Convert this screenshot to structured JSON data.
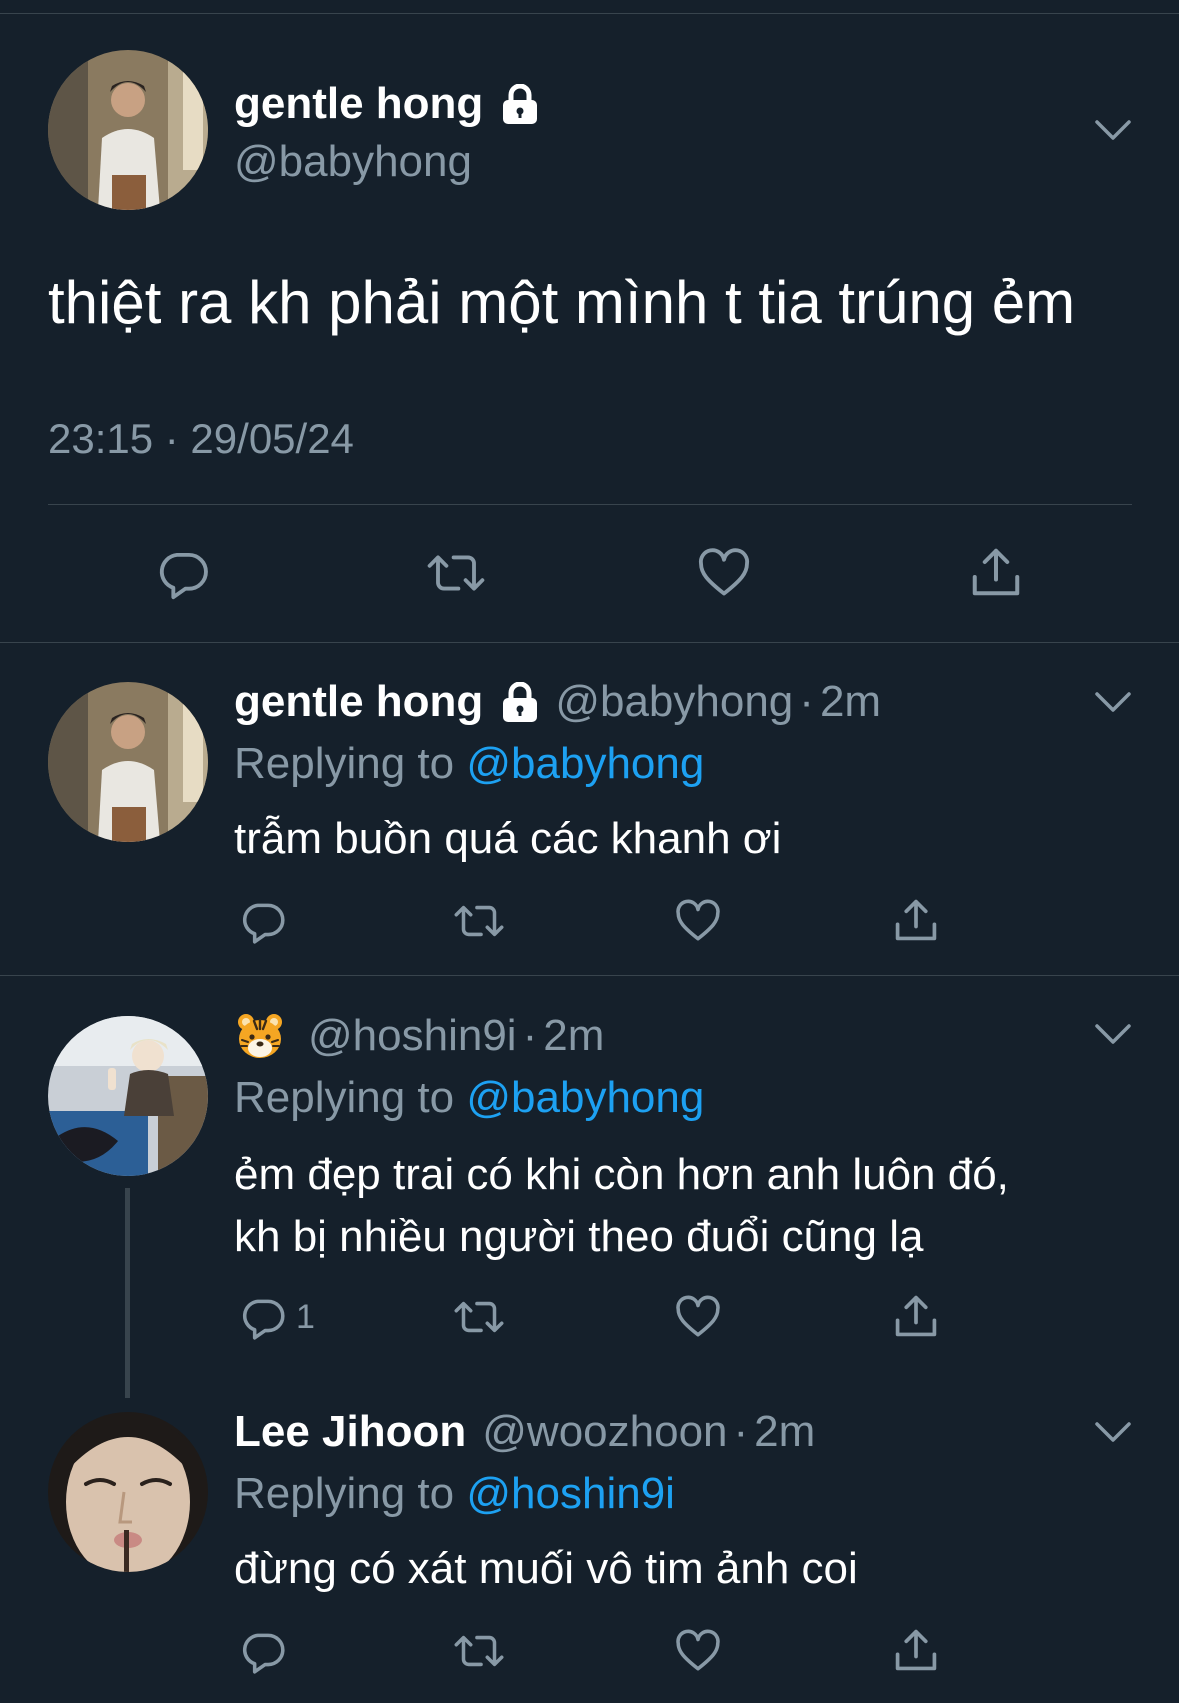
{
  "main_tweet": {
    "name": "gentle hong",
    "handle": "@babyhong",
    "text": "thiệt ra kh phải một mình t tia trúng ẻm",
    "timestamp": "23:15 · 29/05/24"
  },
  "replies": [
    {
      "name": "gentle hong",
      "handle": "@babyhong",
      "time": "2m",
      "replying_label": "Replying to",
      "replying_to": "@babyhong",
      "text_lines": [
        "trẫm buồn quá các khanh ơi"
      ],
      "reply_count": ""
    },
    {
      "name": "",
      "emoji_icon": "tiger-face-icon",
      "handle": "@hoshin9i",
      "time": "2m",
      "replying_label": "Replying to",
      "replying_to": "@babyhong",
      "text_lines": [
        "ẻm đẹp trai có khi còn hơn anh luôn đó,",
        "kh bị nhiều người theo đuổi cũng lạ"
      ],
      "reply_count": "1"
    },
    {
      "name": "Lee Jihoon",
      "handle": "@woozhoon",
      "time": "2m",
      "replying_label": "Replying to",
      "replying_to": "@hoshin9i",
      "text_lines": [
        "đừng có xát muối vô tim ảnh coi"
      ],
      "reply_count": ""
    }
  ],
  "dot": "·",
  "colors": {
    "background": "#15202b",
    "divider": "#38444d",
    "secondary_text": "#8899a6",
    "mention": "#1da1f2"
  },
  "icons": {
    "reply": "speech-bubble-icon",
    "retweet": "retweet-icon",
    "like": "heart-icon",
    "share": "share-icon",
    "more": "chevron-down-icon",
    "protected": "lock-icon"
  }
}
